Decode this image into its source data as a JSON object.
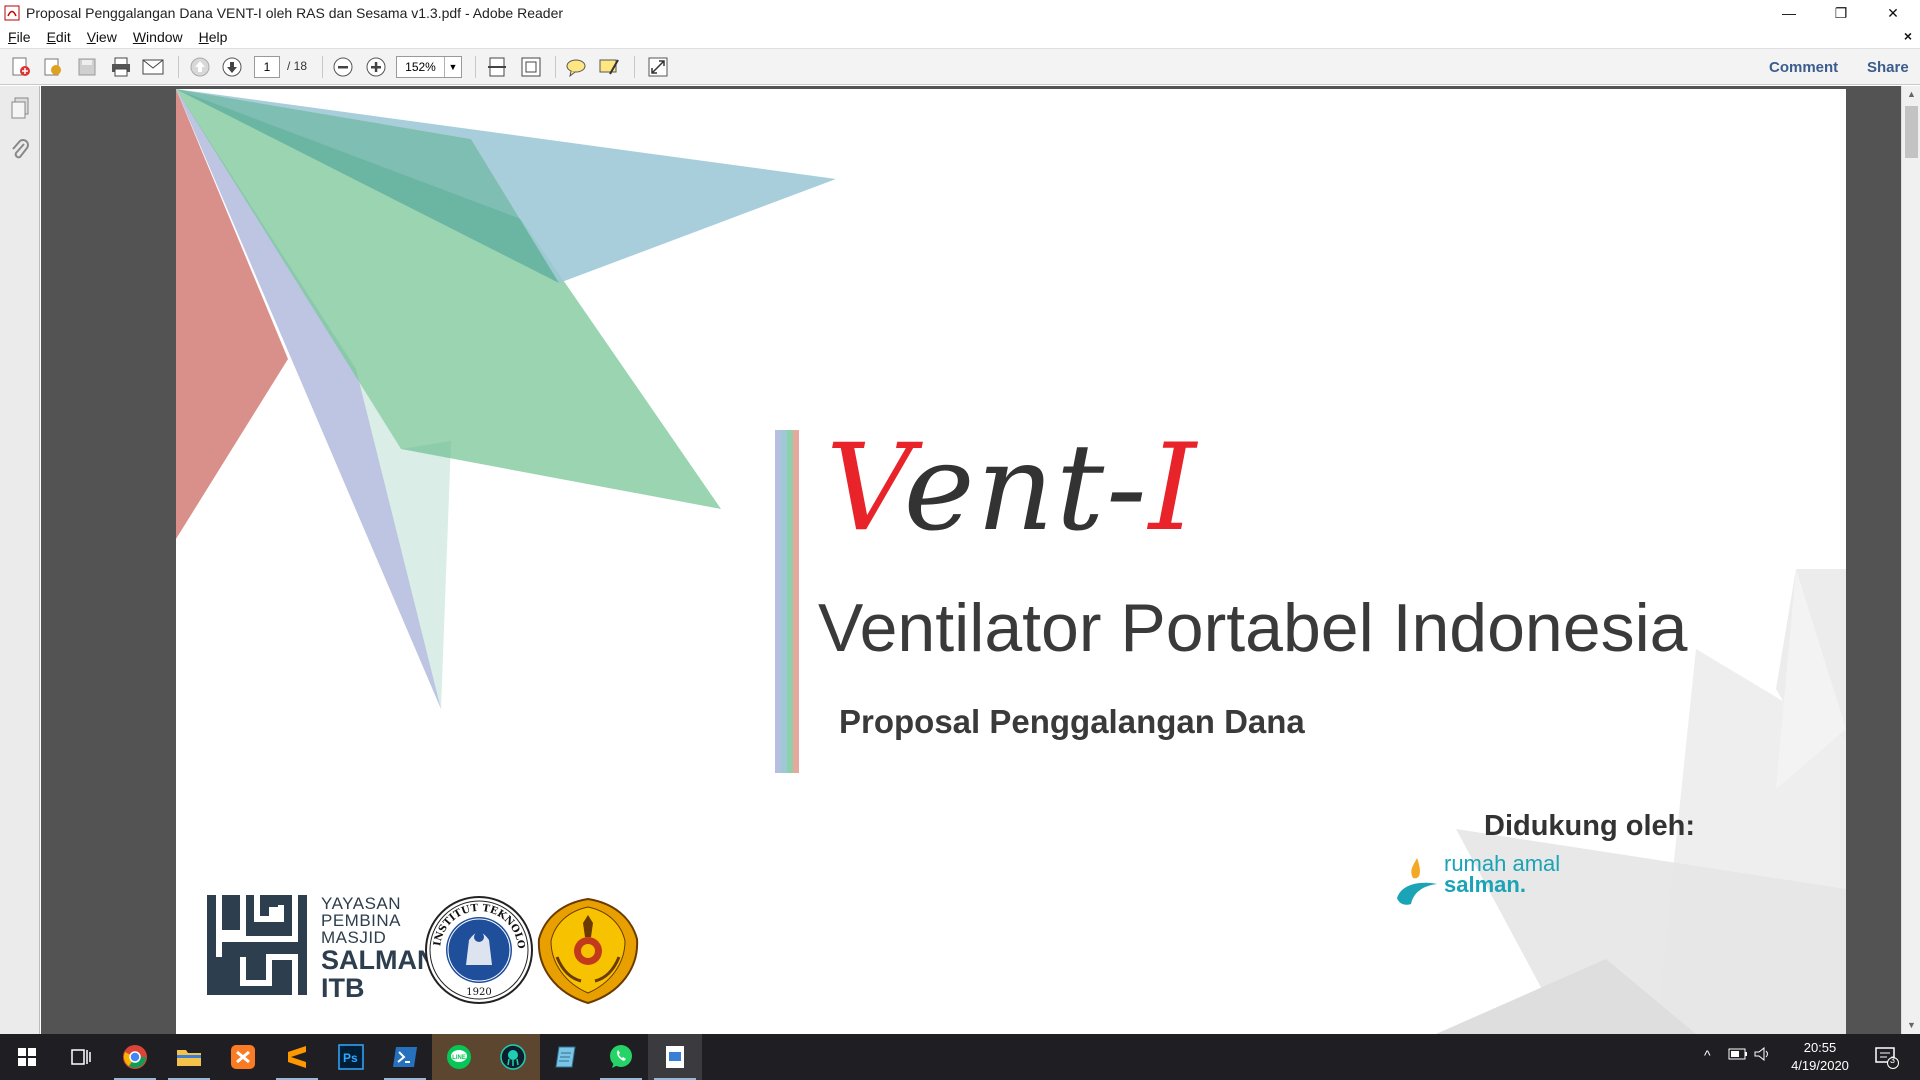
{
  "window": {
    "title": "Proposal Penggalangan Dana VENT-I oleh RAS dan Sesama v1.3.pdf - Adobe Reader",
    "controls": {
      "minimize": "—",
      "restore": "❐",
      "close": "✕"
    }
  },
  "menu": {
    "items": [
      {
        "label": "File",
        "key": "F",
        "rest": "ile"
      },
      {
        "label": "Edit",
        "key": "E",
        "rest": "dit"
      },
      {
        "label": "View",
        "key": "V",
        "rest": "iew"
      },
      {
        "label": "Window",
        "key": "W",
        "rest": "indow"
      },
      {
        "label": "Help",
        "key": "H",
        "rest": "elp"
      }
    ],
    "close": "×"
  },
  "toolbar": {
    "page_current": "1",
    "page_total": "/ 18",
    "zoom": "152%",
    "comment_label": "Comment",
    "share_label": "Share"
  },
  "document": {
    "brand_part1": "Vent-",
    "brand_part2": "I",
    "title": "Ventilator Portabel Indonesia",
    "subtitle": "Proposal Penggalangan Dana",
    "support_label": "Didukung oleh:",
    "sponsor_line1": "rumah amal",
    "sponsor_line2": "salman.",
    "ypms_lines": [
      "YAYASAN",
      "PEMBINA",
      "MASJID"
    ],
    "ypms_bold": [
      "SALMAN",
      "ITB"
    ],
    "itb_ring_text": "INSTITUT TEKNOLOGI BANDUNG",
    "itb_year": "1920"
  },
  "taskbar": {
    "apps": [
      "windows-start",
      "task-view",
      "chrome",
      "file-explorer",
      "xampp",
      "sublime-text",
      "photoshop",
      "powershell",
      "line",
      "gitkraken",
      "notepad",
      "whatsapp",
      "adobe-reader"
    ],
    "clock_time": "20:55",
    "clock_date": "4/19/2020",
    "notification_count": "3"
  },
  "colors": {
    "accent_red": "#e8232a",
    "teal": "#1ba3b6",
    "viewer_bg": "#535353",
    "link_blue": "#3b5c8e"
  }
}
